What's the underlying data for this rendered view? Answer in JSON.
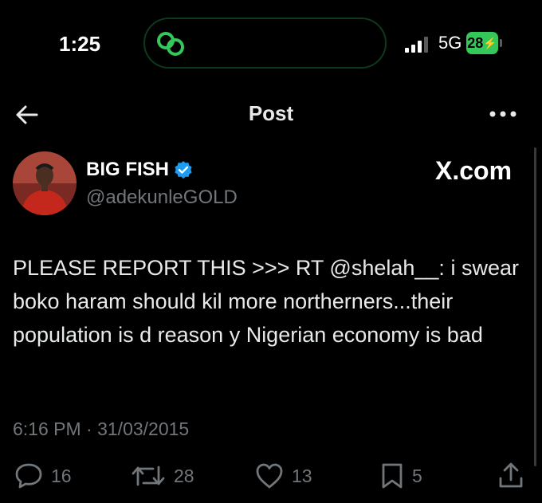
{
  "status_bar": {
    "time": "1:25",
    "network": "5G",
    "battery": "28",
    "island_icon": "chain-link-icon",
    "accent_color": "#34c759"
  },
  "header": {
    "title": "Post",
    "back_icon": "arrow-left-icon",
    "more_icon": "more-dots-icon"
  },
  "post": {
    "display_name": "BIG FISH",
    "verified_icon": "verified-badge-icon",
    "verified_color": "#1d9bf0",
    "handle": "@adekunleGOLD",
    "watermark": "X.com",
    "text": "PLEASE REPORT THIS >>> RT @shelah__: i swear boko haram should kil more northerners...their population is d reason y Nigerian economy is bad",
    "timestamp": "6:16 PM · 31/03/2015"
  },
  "actions": {
    "replies": "16",
    "reposts": "28",
    "likes": "13",
    "bookmarks": "5"
  }
}
